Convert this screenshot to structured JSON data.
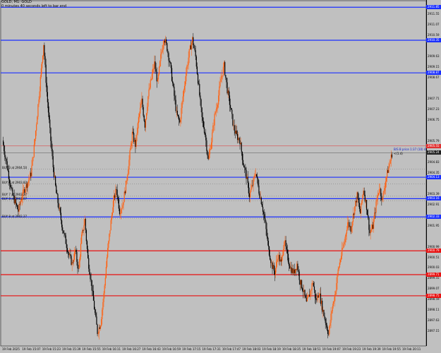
{
  "header": {
    "symbol_line": "GOLD, M1:  GOLD",
    "status_line": "0 minutes 40 seconds left to bar end"
  },
  "price_axis": {
    "labels": [
      {
        "price": 2911.55,
        "text": "2911.55"
      },
      {
        "price": 2911.07,
        "text": "2911.07"
      },
      {
        "price": 2910.59,
        "text": "2910.59"
      },
      {
        "price": 2909.63,
        "text": "2909.63"
      },
      {
        "price": 2909.15,
        "text": "2909.15"
      },
      {
        "price": 2908.67,
        "text": "2908.67"
      },
      {
        "price": 2907.71,
        "text": "2907.71"
      },
      {
        "price": 2907.23,
        "text": "2907.23"
      },
      {
        "price": 2906.75,
        "text": "2906.75"
      },
      {
        "price": 2905.79,
        "text": "2905.79"
      },
      {
        "price": 2904.83,
        "text": "2904.83"
      },
      {
        "price": 2904.35,
        "text": "2904.35"
      },
      {
        "price": 2903.39,
        "text": "2903.39"
      },
      {
        "price": 2902.91,
        "text": "2902.91"
      },
      {
        "price": 2901.95,
        "text": "2901.95"
      },
      {
        "price": 2900.99,
        "text": "2900.99"
      },
      {
        "price": 2900.51,
        "text": "2900.51"
      },
      {
        "price": 2900.03,
        "text": "2900.03"
      },
      {
        "price": 2899.55,
        "text": "2899.55"
      },
      {
        "price": 2899.07,
        "text": "2899.07"
      },
      {
        "price": 2898.59,
        "text": "2898.59"
      },
      {
        "price": 2898.11,
        "text": "2898.11"
      },
      {
        "price": 2897.63,
        "text": "2897.63"
      },
      {
        "price": 2897.15,
        "text": "2897.15"
      }
    ],
    "tags": [
      {
        "price": 2911.85,
        "text": "2911.85",
        "color": "#1a2fff"
      },
      {
        "price": 2910.35,
        "text": "2910.35",
        "color": "#1a2fff"
      },
      {
        "price": 2908.87,
        "text": "2908.87",
        "color": "#1a2fff"
      },
      {
        "price": 2905.55,
        "text": "2905.55",
        "color": "#e03030"
      },
      {
        "price": 2905.24,
        "text": "2905.24",
        "color": "#202020"
      },
      {
        "price": 2904.13,
        "text": "2904.13",
        "color": "#1a2fff"
      },
      {
        "price": 2903.16,
        "text": "2903.16",
        "color": "#1a2fff"
      },
      {
        "price": 2902.33,
        "text": "2902.33",
        "color": "#1a2fff"
      },
      {
        "price": 2900.79,
        "text": "2900.79",
        "color": "#e81010"
      },
      {
        "price": 2899.71,
        "text": "2899.71",
        "color": "#e81010"
      },
      {
        "price": 2898.75,
        "text": "2898.75",
        "color": "#e81010"
      }
    ]
  },
  "levels": [
    {
      "price": 2911.85,
      "color": "#1a2fff",
      "width": 1.2
    },
    {
      "price": 2910.35,
      "color": "#1a2fff",
      "width": 1.2
    },
    {
      "price": 2908.87,
      "color": "#1a2fff",
      "width": 1.2
    },
    {
      "price": 2905.55,
      "color": "#e03030",
      "width": 0.5
    },
    {
      "price": 2904.13,
      "color": "#1a2fff",
      "width": 1.2
    },
    {
      "price": 2903.16,
      "color": "#1a2fff",
      "width": 1.2
    },
    {
      "price": 2902.33,
      "color": "#1a2fff",
      "width": 1.2
    },
    {
      "price": 2900.79,
      "color": "#e81010",
      "width": 1.2
    },
    {
      "price": 2899.71,
      "color": "#e81010",
      "width": 1.2
    },
    {
      "price": 2898.75,
      "color": "#e81010",
      "width": 1.2
    }
  ],
  "bid_price": 2905.24,
  "orders": [
    {
      "text": "BUY 3 at 2904.50",
      "price": 2904.5
    },
    {
      "text": "BUY 4 at 2903.82",
      "price": 2903.82
    },
    {
      "text": "BUY 7 at 2903.27",
      "price": 2903.27
    },
    {
      "text": "BUY 8 at 2903.07",
      "price": 2903.07
    },
    {
      "text": "BUY 8 at 2902.27",
      "price": 2902.27
    }
  ],
  "annotations": {
    "signal_text": "B/S B price 1:37  (10) 4",
    "arrow_text": "<(1.4)",
    "signal_price": 2905.55
  },
  "time_axis": {
    "labels": [
      "19 Feb 2025",
      "19 Feb 15:07",
      "19 Feb 15:23",
      "19 Feb 15:39",
      "19 Feb 15:55",
      "19 Feb 16:11",
      "19 Feb 16:27",
      "19 Feb 16:43",
      "19 Feb 16:59",
      "19 Feb 17:15",
      "19 Feb 17:31",
      "19 Feb 17:47",
      "19 Feb 18:03",
      "19 Feb 18:19",
      "19 Feb 18:35",
      "19 Feb 18:51",
      "19 Feb 19:07",
      "19 Feb 19:23",
      "19 Feb 19:39",
      "19 Feb 19:55",
      "19 Feb 20:11"
    ]
  },
  "chart_data": {
    "type": "candlestick",
    "symbol": "GOLD",
    "timeframe": "M1",
    "ylim": [
      2896.6,
      2912.05
    ],
    "bull_color": "#ff6010",
    "bear_color": "#000000",
    "close_path": [
      2905.8,
      2905.0,
      2904.2,
      2903.4,
      2903.0,
      2902.6,
      2903.2,
      2903.6,
      2903.9,
      2904.3,
      2905.5,
      2907.0,
      2908.6,
      2910.2,
      2908.0,
      2906.2,
      2904.6,
      2903.4,
      2902.6,
      2901.8,
      2901.2,
      2900.6,
      2900.2,
      2900.8,
      2899.9,
      2901.4,
      2902.2,
      2900.4,
      2899.4,
      2898.2,
      2897.1,
      2897.5,
      2898.8,
      2900.5,
      2901.8,
      2903.0,
      2903.6,
      2902.6,
      2902.9,
      2903.8,
      2904.9,
      2906.1,
      2905.6,
      2906.8,
      2907.6,
      2906.5,
      2907.8,
      2908.6,
      2909.3,
      2908.4,
      2909.6,
      2910.5,
      2910.0,
      2909.2,
      2908.1,
      2907.0,
      2906.6,
      2907.8,
      2908.9,
      2909.8,
      2910.4,
      2909.6,
      2908.2,
      2906.8,
      2906.1,
      2904.9,
      2905.8,
      2906.9,
      2907.6,
      2908.6,
      2909.2,
      2908.1,
      2907.3,
      2906.4,
      2906.0,
      2905.8,
      2904.8,
      2904.2,
      2903.3,
      2903.8,
      2904.4,
      2903.5,
      2902.9,
      2902.0,
      2900.9,
      2900.2,
      2899.8,
      2900.6,
      2900.2,
      2901.3,
      2900.5,
      2900.0,
      2899.8,
      2900.2,
      2899.4,
      2899.0,
      2898.4,
      2898.8,
      2899.4,
      2898.5,
      2898.9,
      2898.2,
      2897.6,
      2897.0,
      2898.1,
      2898.8,
      2899.9,
      2900.6,
      2901.2,
      2902.1,
      2901.8,
      2902.6,
      2903.3,
      2902.5,
      2903.6,
      2902.8,
      2901.6,
      2901.9,
      2902.9,
      2903.7,
      2903.1,
      2904.0,
      2904.6,
      2905.2
    ]
  }
}
